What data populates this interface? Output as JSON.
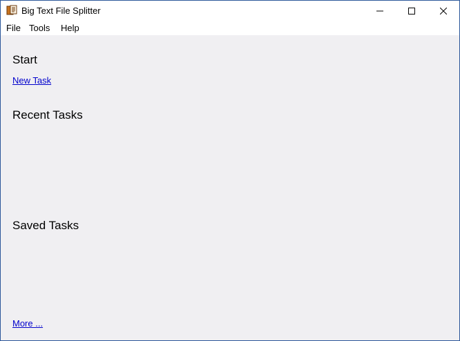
{
  "window": {
    "title": "Big Text File Splitter",
    "icon": "document-split-icon",
    "controls": {
      "minimize": "minimize-icon",
      "maximize": "maximize-icon",
      "close": "close-icon"
    }
  },
  "menu": {
    "items": [
      "File",
      "Tools",
      "Help"
    ]
  },
  "start": {
    "heading": "Start",
    "new_task": "New Task"
  },
  "recent": {
    "heading": "Recent Tasks"
  },
  "saved": {
    "heading": "Saved Tasks",
    "more": "More ..."
  },
  "colors": {
    "content_bg": "#f0eff2",
    "link": "#0000cc",
    "border": "#2b579a"
  }
}
